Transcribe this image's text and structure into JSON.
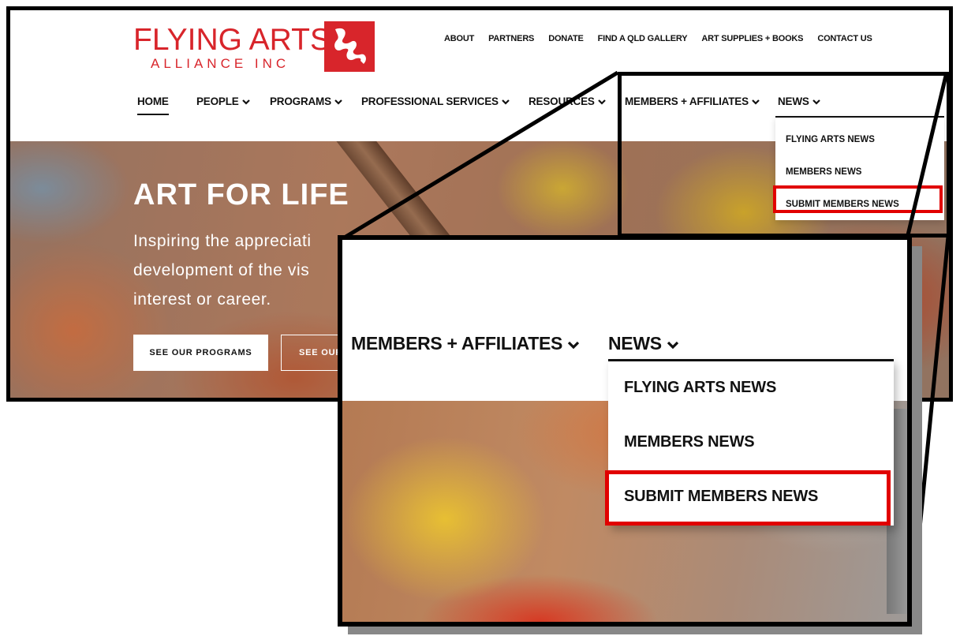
{
  "logo": {
    "title": "FLYING ARTS",
    "subtitle": "ALLIANCE INC",
    "mark": "stylized-figure-icon",
    "brand_color": "#d8252b"
  },
  "top_links": [
    "ABOUT",
    "PARTNERS",
    "DONATE",
    "FIND A QLD GALLERY",
    "ART SUPPLIES + BOOKS",
    "CONTACT US"
  ],
  "main_nav": {
    "home": "HOME",
    "people": "PEOPLE",
    "programs": "PROGRAMS",
    "professional_services": "PROFESSIONAL SERVICES",
    "resources": "RESOURCES",
    "members_affiliates": "MEMBERS + AFFILIATES",
    "news": "NEWS"
  },
  "hero": {
    "title": "ART FOR LIFE",
    "text_line1": "Inspiring the appreciati",
    "text_line2": "development of the vis",
    "text_line3": "interest or career.",
    "btn_primary": "SEE OUR PROGRAMS",
    "btn_secondary": "SEE OUR"
  },
  "news_dropdown": {
    "items": [
      "FLYING ARTS NEWS",
      "MEMBERS NEWS",
      "SUBMIT MEMBERS NEWS"
    ],
    "highlighted": "SUBMIT MEMBERS NEWS",
    "highlight_color": "#e10000"
  },
  "zoom": {
    "members_affiliates": "MEMBERS + AFFILIATES",
    "news": "NEWS",
    "items": [
      "FLYING ARTS NEWS",
      "MEMBERS NEWS",
      "SUBMIT MEMBERS NEWS"
    ]
  }
}
